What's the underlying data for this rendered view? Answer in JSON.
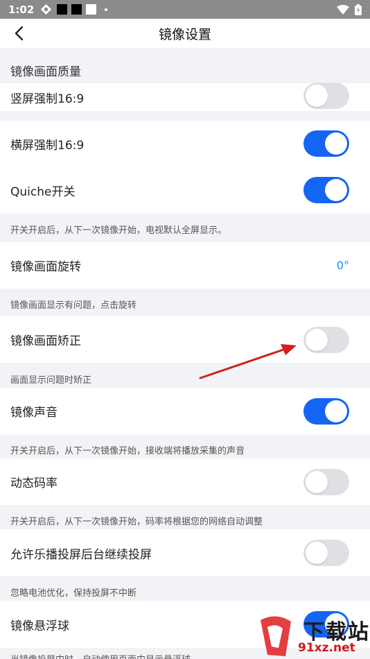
{
  "status_bar": {
    "time": "1:02"
  },
  "header": {
    "title": "镜像设置"
  },
  "section": {
    "title": "镜像画面质量"
  },
  "rows": {
    "portrait": {
      "label": "竖屏强制16:9",
      "on": false
    },
    "landscape": {
      "label": "横屏强制16:9",
      "on": true
    },
    "quiche": {
      "label": "Quiche开关",
      "on": true
    },
    "rotation": {
      "label": "镜像画面旋转",
      "value": "0°"
    },
    "correction": {
      "label": "镜像画面矫正",
      "on": false
    },
    "sound": {
      "label": "镜像声音",
      "on": true
    },
    "bitrate": {
      "label": "动态码率",
      "on": false
    },
    "background": {
      "label": "允许乐播投屏后台继续投屏",
      "on": false
    },
    "floating": {
      "label": "镜像悬浮球",
      "on": true
    }
  },
  "hints": {
    "quiche": "开关开启后，从下一次镜像开始，电视默认全屏显示。",
    "rotation": "镜像画面显示有问题，点击旋转",
    "correction": "画面显示问题时矫正",
    "sound": "开关开启后，从下一次镜像开始，接收端将播放采集的声音",
    "bitrate": "开关开启后，从下一次镜像开始，码率将根据您的网络自动调整",
    "background": "忽略电池优化，保持投屏不中断",
    "floating": "当镜像投屏中时，自动使用页面中显示悬浮球"
  },
  "watermark": {
    "brand": "下载站",
    "site": "91xz.net"
  },
  "colors": {
    "accent": "#1565f5",
    "value_blue": "#1a8cff",
    "arrow_red": "#d21f1f"
  }
}
